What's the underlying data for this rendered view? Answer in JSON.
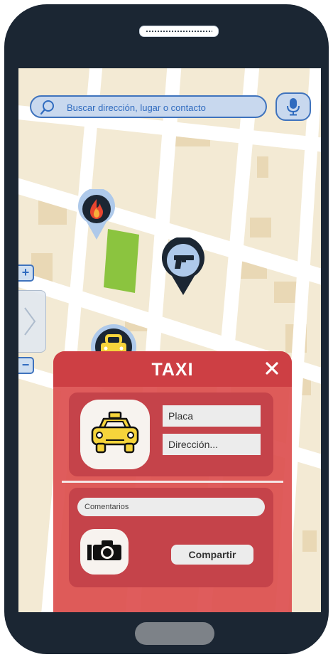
{
  "search": {
    "placeholder": "Buscar dirección, lugar o contacto"
  },
  "map": {
    "markers": [
      {
        "name": "fire-marker",
        "icon": "fire-icon"
      },
      {
        "name": "robbery-marker",
        "icon": "gun-icon"
      },
      {
        "name": "taxi-marker",
        "icon": "taxi-icon"
      }
    ],
    "zoom_in_label": "+",
    "zoom_out_label": "−"
  },
  "panel": {
    "title": "TAXI",
    "close_label": "✕",
    "plate_placeholder": "Placa",
    "address_placeholder": "Dirección...",
    "comments_placeholder": "Comentarios",
    "share_label": "Compartir"
  },
  "colors": {
    "accent_blue": "#3f73bd",
    "panel_red": "#cd3f44",
    "taxi_yellow": "#f6d43b",
    "park_green": "#8bc43f"
  }
}
